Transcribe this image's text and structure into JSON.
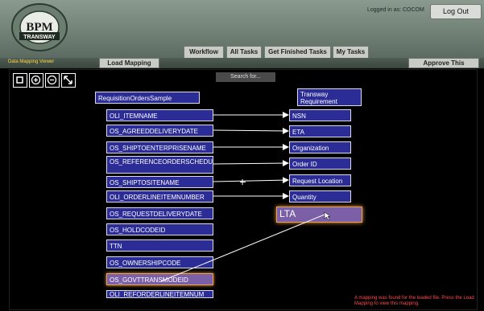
{
  "header": {
    "logo": {
      "text": "BPM",
      "subtext": "TRANSWAY"
    },
    "logged_in": "Logged in as: COCOM",
    "logout_label": "Log Out",
    "nav": [
      "Workflow",
      "All Tasks",
      "Get Finished Tasks",
      "My Tasks"
    ]
  },
  "subbar": {
    "title": "Data Mapping Viewer",
    "load_label": "Load Mapping",
    "approve_label": "Approve This Mapping"
  },
  "toolbar": {
    "icons": [
      "fit-icon",
      "zoom-in-icon",
      "zoom-out-icon",
      "expand-icon"
    ]
  },
  "search": {
    "placeholder": "Search for..."
  },
  "mapping": {
    "source_title": "RequisitionOrdersSample",
    "target_title": "Transway Requirement",
    "sources": [
      "OLI_ITEMNAME",
      "OS_AGREEDDELIVERYDATE",
      "OS_SHIPTOENTERPRISENAME",
      "OS_REFERENCEORDERSCHEDULENUM",
      "OS_SHIPTOSITENAME",
      "OLI_ORDERLINEITEMNUMBER",
      "OS_REQUESTDELIVERYDATE",
      "OS_HOLDCODEID",
      "TTN",
      "OS_OWNERSHIPCODE",
      "OS_GOVTTRANSMODEID",
      "OLI_REFORDERLINEITEMNUM"
    ],
    "targets": [
      "NSN",
      "ETA",
      "Organization",
      "Order ID",
      "Request Location",
      "Quantity",
      "LTA"
    ]
  },
  "status_message": "A mapping was found for the loaded file. Press the Load Mapping to view this mapping."
}
